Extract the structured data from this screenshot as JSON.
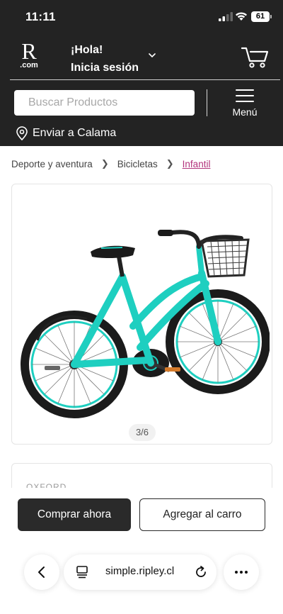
{
  "status_bar": {
    "time": "11:11",
    "battery": "61"
  },
  "header": {
    "logo_letter": "R",
    "logo_suffix": ".com",
    "greeting": "¡Hola!",
    "login": "Inicia sesión",
    "search_placeholder": "Buscar Productos",
    "menu_label": "Menú",
    "shipping": "Enviar a Calama"
  },
  "breadcrumb": [
    "Deporte y aventura",
    "Bicicletas",
    "Infantil"
  ],
  "gallery": {
    "pager": "3/6"
  },
  "product": {
    "brand": "OXFORD"
  },
  "actions": {
    "buy_now": "Comprar ahora",
    "add_to_cart": "Agregar al carro"
  },
  "browser": {
    "url": "simple.ripley.cl"
  },
  "colors": {
    "header_bg": "#232323",
    "accent": "#b2337c",
    "bike_frame": "#1ecfc0"
  },
  "icons": [
    "signal-icon",
    "wifi-icon",
    "battery-icon",
    "chevron-down-icon",
    "cart-icon",
    "hamburger-icon",
    "location-pin-icon",
    "back-icon",
    "tabs-icon",
    "reload-icon",
    "more-icon"
  ]
}
